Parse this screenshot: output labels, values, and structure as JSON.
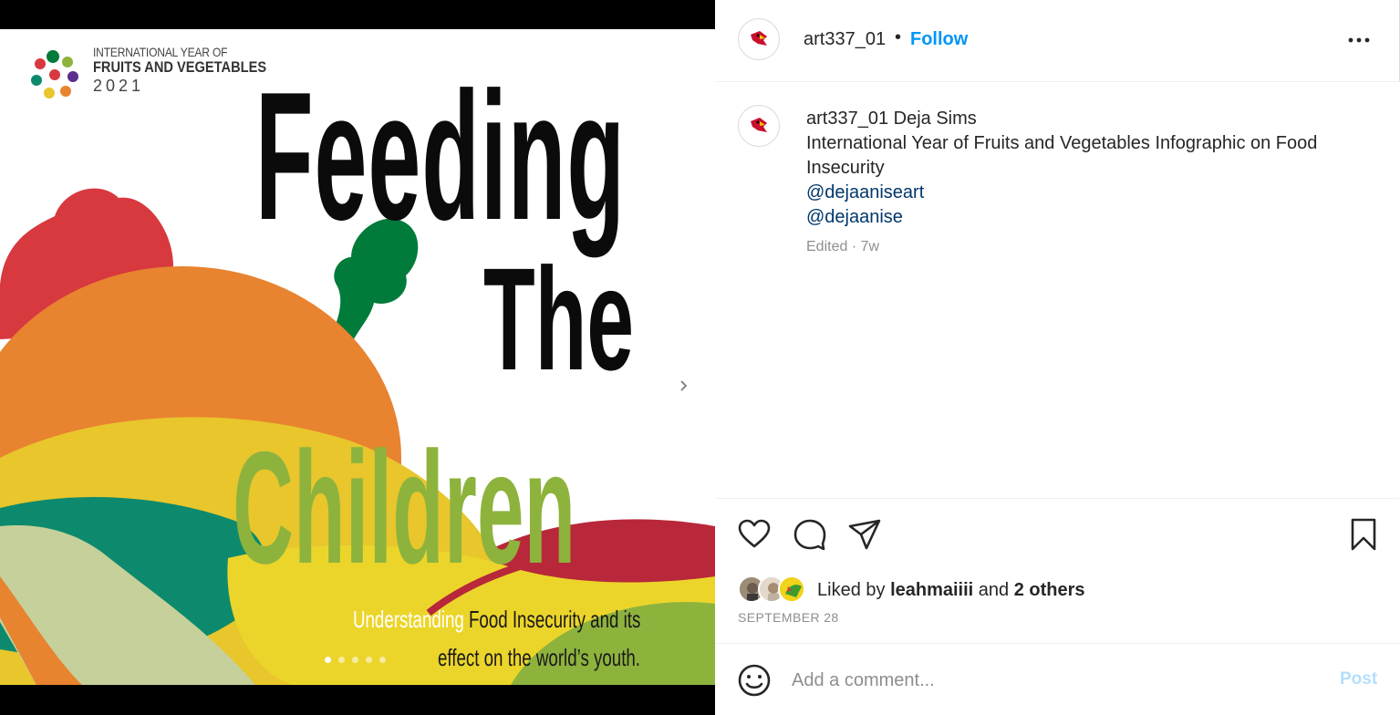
{
  "post_image": {
    "logo": {
      "line1": "INTERNATIONAL YEAR OF",
      "line2": "FRUITS AND VEGETABLES",
      "line3": "2021"
    },
    "headline": {
      "line1": "Feeding",
      "line2": "The",
      "line3": "Children"
    },
    "subtext": {
      "part1": "Understanding",
      "part2": "Food Insecurity and its",
      "line2": "effect on the world’s youth."
    },
    "slide_count": 5,
    "active_slide": 1,
    "colors": {
      "orange": "#e88330",
      "red": "#d7393f",
      "green": "#007b3a",
      "yellow": "#e8c62c",
      "teal": "#0d8a6d",
      "sage": "#c6d09a",
      "purple": "#5b2d8e",
      "lime": "#8db33d",
      "maroon": "#b8283a"
    }
  },
  "header": {
    "username": "art337_01",
    "separator": "•",
    "follow_label": "Follow",
    "more_icon": "more-horizontal-icon"
  },
  "caption": {
    "username": "art337_01",
    "name": "Deja Sims",
    "text": "International Year of Fruits and Vegetables Infographic on Food Insecurity",
    "mentions": [
      "@dejaaniseart",
      "@dejaanise"
    ],
    "meta": "Edited · 7w"
  },
  "actions": {
    "like_icon": "heart-icon",
    "comment_icon": "comment-icon",
    "share_icon": "paper-plane-icon",
    "save_icon": "bookmark-icon"
  },
  "likes": {
    "prefix": "Liked by",
    "user": "leahmaiiii",
    "conjunction": "and",
    "others": "2 others"
  },
  "date": "SEPTEMBER 28",
  "comment_box": {
    "emoji_icon": "smiley-icon",
    "placeholder": "Add a comment...",
    "post_label": "Post"
  }
}
